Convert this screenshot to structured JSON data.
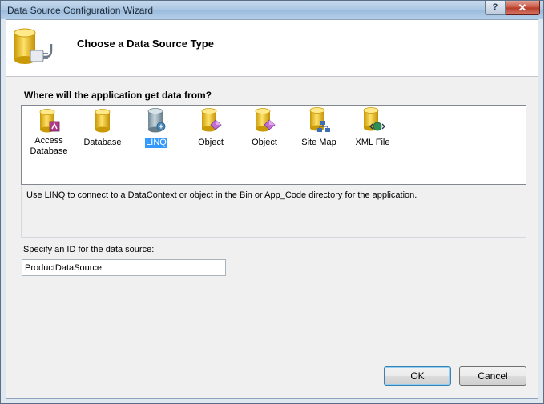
{
  "window": {
    "title": "Data Source Configuration Wizard",
    "help_label": "?",
    "close_label": "✕"
  },
  "header": {
    "title": "Choose a Data Source Type",
    "icon": "database-plug-icon"
  },
  "question": "Where will the application get data from?",
  "types": [
    {
      "label": "Access Database",
      "icon": "access-database-icon",
      "selected": false
    },
    {
      "label": "Database",
      "icon": "database-icon",
      "selected": false
    },
    {
      "label": "LINQ",
      "icon": "linq-icon",
      "selected": true
    },
    {
      "label": "Object",
      "icon": "object-icon",
      "selected": false
    },
    {
      "label": "Object",
      "icon": "object-icon",
      "selected": false
    },
    {
      "label": "Site Map",
      "icon": "site-map-icon",
      "selected": false
    },
    {
      "label": "XML File",
      "icon": "xml-file-icon",
      "selected": false
    }
  ],
  "description": "Use LINQ to connect to a DataContext or object in the Bin or App_Code directory for the application.",
  "id_field": {
    "label": "Specify an ID for the data source:",
    "value": "ProductDataSource"
  },
  "buttons": {
    "ok": "OK",
    "cancel": "Cancel"
  },
  "colors": {
    "selection": "#3399ff",
    "database_yellow": "#f0c419",
    "linq_gray": "#8fa7b3"
  }
}
